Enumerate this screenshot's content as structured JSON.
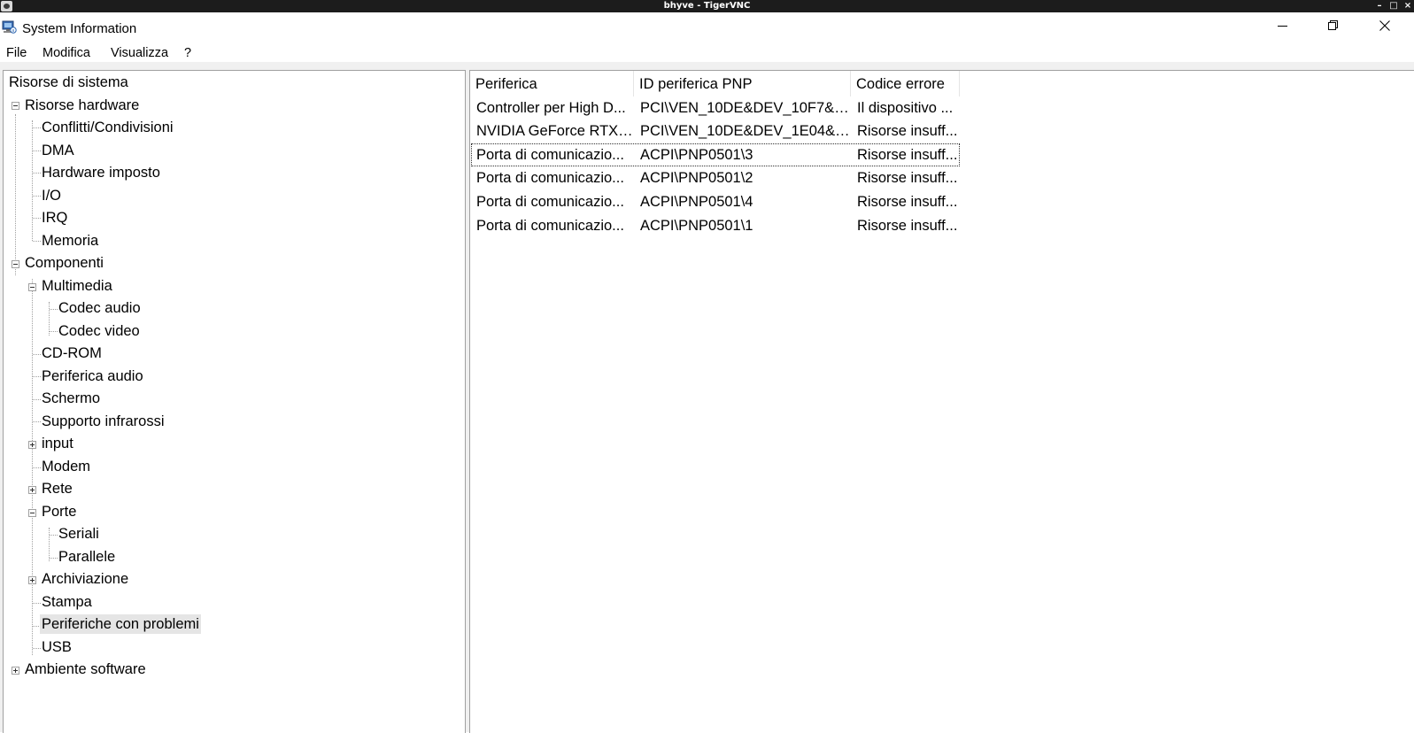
{
  "vnc": {
    "title": "bhyve - TigerVNC",
    "controls": [
      "–",
      "□",
      "×"
    ]
  },
  "window": {
    "title": "System Information"
  },
  "menu": [
    "File",
    "Modifica",
    "Visualizza",
    "?"
  ],
  "tree": {
    "root": "Risorse di sistema",
    "items": [
      {
        "label": "Risorse hardware"
      },
      {
        "label": "Conflitti/Condivisioni"
      },
      {
        "label": "DMA"
      },
      {
        "label": "Hardware imposto"
      },
      {
        "label": "I/O"
      },
      {
        "label": "IRQ"
      },
      {
        "label": "Memoria"
      },
      {
        "label": "Componenti"
      },
      {
        "label": "Multimedia"
      },
      {
        "label": "Codec audio"
      },
      {
        "label": "Codec video"
      },
      {
        "label": "CD-ROM"
      },
      {
        "label": "Periferica audio"
      },
      {
        "label": "Schermo"
      },
      {
        "label": "Supporto infrarossi"
      },
      {
        "label": "input"
      },
      {
        "label": "Modem"
      },
      {
        "label": "Rete"
      },
      {
        "label": "Porte"
      },
      {
        "label": "Seriali"
      },
      {
        "label": "Parallele"
      },
      {
        "label": "Archiviazione"
      },
      {
        "label": "Stampa"
      },
      {
        "label": "Periferiche con problemi"
      },
      {
        "label": "USB"
      },
      {
        "label": "Ambiente software"
      }
    ]
  },
  "table": {
    "columns": [
      "Periferica",
      "ID periferica PNP",
      "Codice errore"
    ],
    "rows": [
      [
        "Controller per High D...",
        "PCI\\VEN_10DE&DEV_10F7&S...",
        "Il dispositivo ..."
      ],
      [
        "NVIDIA GeForce RTX ...",
        "PCI\\VEN_10DE&DEV_1E04&S...",
        "Risorse insuff..."
      ],
      [
        "Porta di comunicazio...",
        "ACPI\\PNP0501\\3",
        "Risorse insuff..."
      ],
      [
        "Porta di comunicazio...",
        "ACPI\\PNP0501\\2",
        "Risorse insuff..."
      ],
      [
        "Porta di comunicazio...",
        "ACPI\\PNP0501\\4",
        "Risorse insuff..."
      ],
      [
        "Porta di comunicazio...",
        "ACPI\\PNP0501\\1",
        "Risorse insuff..."
      ]
    ]
  }
}
